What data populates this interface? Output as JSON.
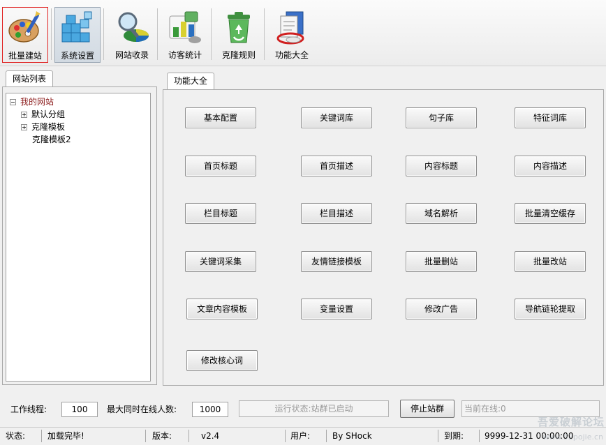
{
  "toolbar": {
    "buttons": [
      {
        "label": "批量建站",
        "icon": "paint-palette-icon"
      },
      {
        "label": "系统设置",
        "icon": "blue-cubes-icon"
      },
      {
        "label": "网站收录",
        "icon": "magnifier-pie-icon"
      },
      {
        "label": "访客统计",
        "icon": "bar-stats-icon"
      },
      {
        "label": "克隆规则",
        "icon": "recycle-bin-icon"
      },
      {
        "label": "功能大全",
        "icon": "documents-icon"
      }
    ]
  },
  "left_panel": {
    "tab": "网站列表",
    "tree": {
      "root": "我的网站",
      "children": [
        "默认分组",
        "克隆模板",
        "克隆模板2"
      ]
    }
  },
  "right_panel": {
    "tab": "功能大全",
    "buttons": [
      [
        "基本配置",
        "关键词库",
        "句子库",
        "特征词库"
      ],
      [
        "首页标题",
        "首页描述",
        "内容标题",
        "内容描述"
      ],
      [
        "栏目标题",
        "栏目描述",
        "域名解析",
        "批量清空缓存"
      ],
      [
        "关键词采集",
        "友情链接模板",
        "批量删站",
        "批量改站"
      ],
      [
        "文章内容模板",
        "变量设置",
        "修改广告",
        "导航链轮提取"
      ],
      [
        "修改核心词"
      ]
    ]
  },
  "bottom": {
    "threads_label": "工作线程:",
    "threads_value": "100",
    "max_online_label": "最大同时在线人数:",
    "max_online_value": "1000",
    "run_status": "运行状态:站群已启动",
    "stop_button": "停止站群",
    "current_online": "当前在线:0"
  },
  "statusbar": {
    "status_label": "状态:",
    "status_value": "加载完毕!",
    "version_label": "版本:",
    "version_value": "v2.4",
    "user_label": "用户:",
    "user_value": "By SHock",
    "expiry_label": "到期:",
    "expiry_value": "9999-12-31 00:00:00"
  },
  "watermark": {
    "text": "吾爱破解论坛",
    "url": "www.52pojie.cn"
  },
  "colors": {
    "tree_root": "#8b1a1a",
    "active_border": "#e02020"
  }
}
